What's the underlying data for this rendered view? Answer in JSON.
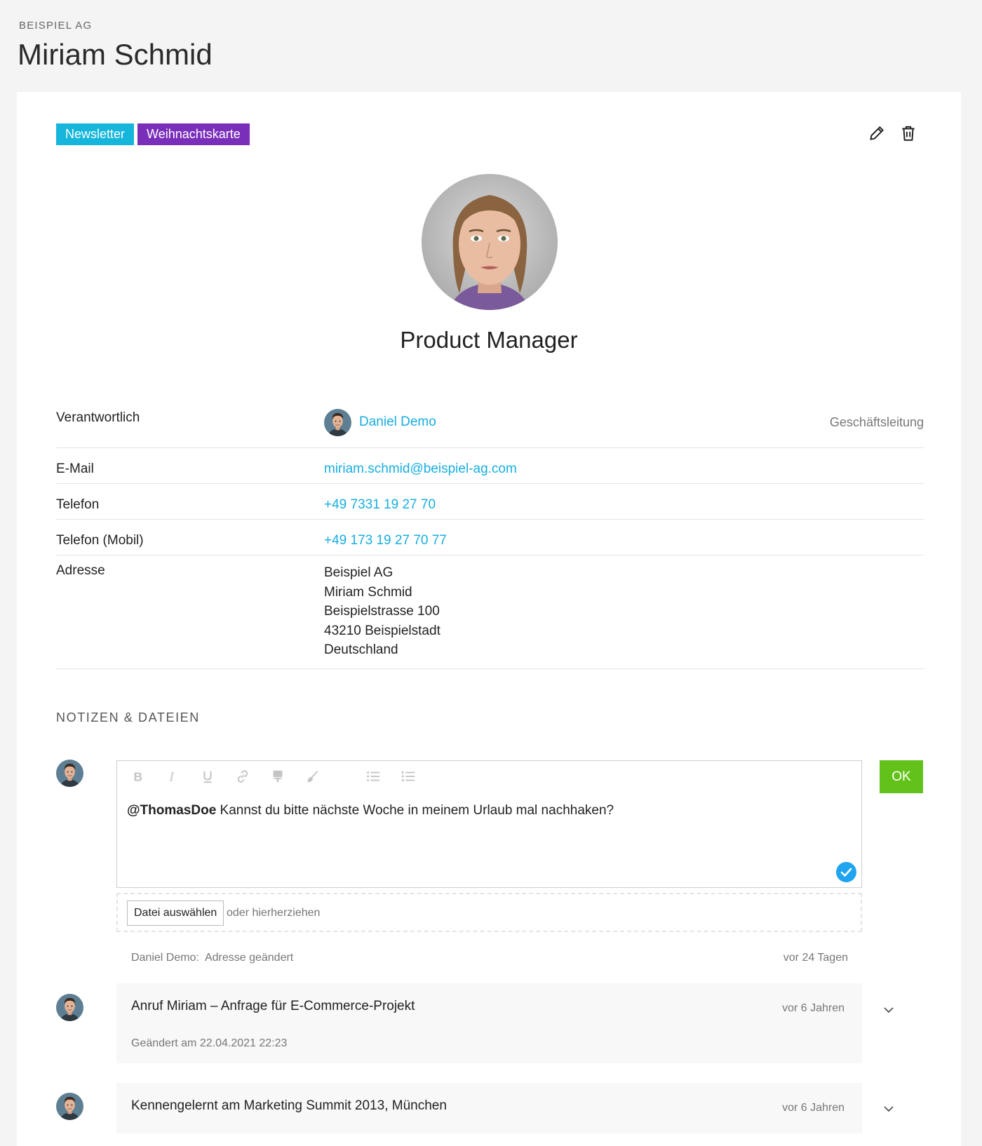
{
  "header": {
    "company": "BEISPIEL AG",
    "name": "Miriam Schmid"
  },
  "tags": [
    {
      "label": "Newsletter",
      "color": "#16b6dc"
    },
    {
      "label": "Weihnachtskarte",
      "color": "#7a2fba"
    }
  ],
  "actions": {
    "edit_icon": "pencil-icon",
    "delete_icon": "trash-icon"
  },
  "profile": {
    "photo": "portrait-photo",
    "job_title": "Product Manager"
  },
  "details": {
    "owner": {
      "label": "Verantwortlich",
      "name": "Daniel Demo",
      "department": "Geschäftsleitung"
    },
    "email": {
      "label": "E-Mail",
      "value": "miriam.schmid@beispiel-ag.com"
    },
    "phone": {
      "label": "Telefon",
      "value": "+49 7331 19 27 70"
    },
    "mobile": {
      "label": "Telefon (Mobil)",
      "value": "+49 173 19 27 70 77"
    },
    "address": {
      "label": "Adresse",
      "lines": [
        "Beispiel AG",
        "Miriam Schmid",
        "Beispielstrasse 100",
        "43210 Beispielstadt",
        "Deutschland"
      ]
    }
  },
  "notes_section": {
    "title": "NOTIZEN & DATEIEN",
    "editor": {
      "toolbar": [
        "bold-icon",
        "italic-icon",
        "underline-icon",
        "link-icon",
        "highlight-icon",
        "brush-icon",
        "bullet-list-icon",
        "numbered-list-icon"
      ],
      "mention": "@ThomasDoe",
      "text": " Kannst du bitte nächste Woche in meinem Urlaub mal nachhaken?"
    },
    "ok_label": "OK",
    "file_button": "Datei auswählen",
    "drop_hint": "oder hierherziehen",
    "activity": {
      "text": "Daniel Demo:  Adresse geändert",
      "when": "vor 24 Tagen"
    },
    "notes": [
      {
        "title": "Anruf Miriam – Anfrage für E-Commerce-Projekt",
        "time": "vor 6 Jahren",
        "meta": "Geändert am 22.04.2021 22:23"
      },
      {
        "title": "Kennengelernt am Marketing Summit 2013, München",
        "time": "vor 6 Jahren"
      }
    ]
  },
  "colors": {
    "accent": "#18aee0",
    "ok_green": "#63c21a",
    "tag_cyan": "#16b6dc",
    "tag_purple": "#7a2fba"
  }
}
